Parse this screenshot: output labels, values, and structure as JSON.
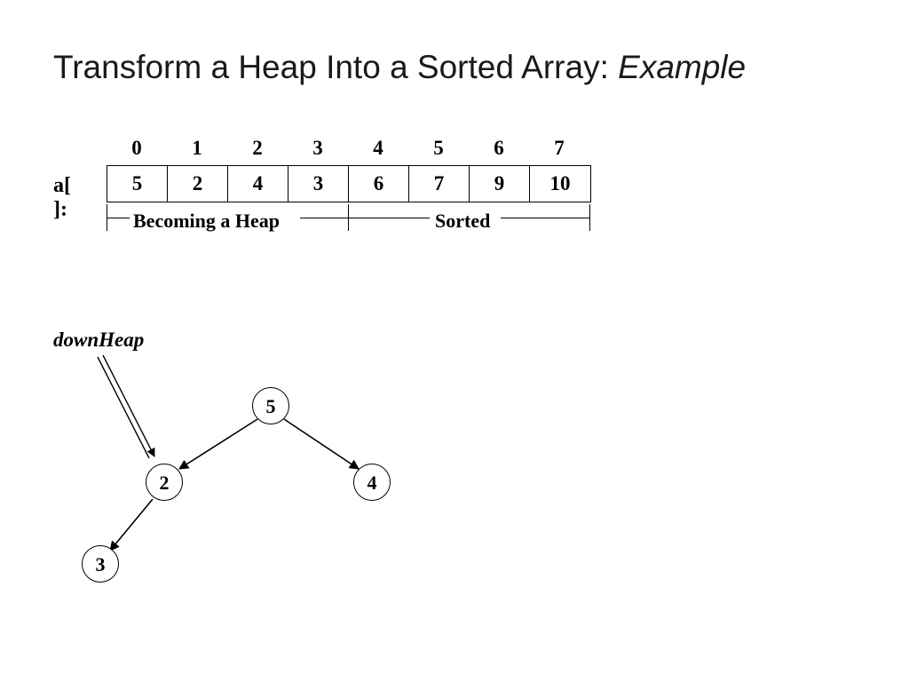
{
  "title_main": "Transform a Heap Into a Sorted Array: ",
  "title_em": "Example",
  "array_label": "a[ ]:",
  "indices": [
    "0",
    "1",
    "2",
    "3",
    "4",
    "5",
    "6",
    "7"
  ],
  "values": [
    "5",
    "2",
    "4",
    "3",
    "6",
    "7",
    "9",
    "10"
  ],
  "range_heap_label": "Becoming a Heap",
  "range_sorted_label": "Sorted",
  "downheap_label": "downHeap",
  "tree": {
    "n0": "5",
    "n1": "2",
    "n2": "4",
    "n3": "3"
  }
}
